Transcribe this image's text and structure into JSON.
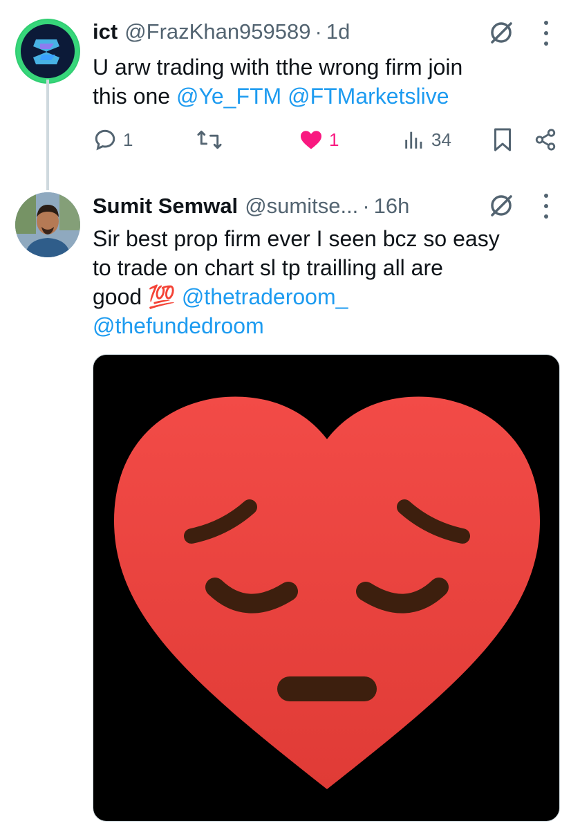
{
  "tweets": [
    {
      "name": "ict",
      "handle": "@FrazKhan959589",
      "separator": "·",
      "time": "1d",
      "text": {
        "line1": "U arw trading with tthe wrong firm join",
        "line2_prefix": "this one ",
        "mention1": "@Ye_FTM",
        "mention2": "@FTMarketslive"
      },
      "actions": {
        "replies": "1",
        "reposts": "",
        "likes": "1",
        "views": "34"
      }
    },
    {
      "name": "Sumit Semwal",
      "handle": "@sumitse...",
      "separator": "·",
      "time": "16h",
      "text": {
        "line1": "Sir best prop firm ever I seen bcz so easy",
        "line2": "to trade on chart sl tp trailling all are",
        "line3_prefix": "good ",
        "emoji": "💯",
        "mention1": "@thetraderoom_",
        "mention2": "@thefundedroom"
      }
    }
  ],
  "colors": {
    "accent": "#1d9bf0",
    "like": "#f91880",
    "muted": "#536471",
    "heart_top": "#f24b47",
    "heart_bottom": "#e03b36",
    "face_features": "#3d1f0e"
  },
  "icons": [
    "grok-icon",
    "more-icon",
    "reply-icon",
    "repost-icon",
    "like-icon",
    "views-icon",
    "bookmark-icon",
    "share-icon"
  ]
}
